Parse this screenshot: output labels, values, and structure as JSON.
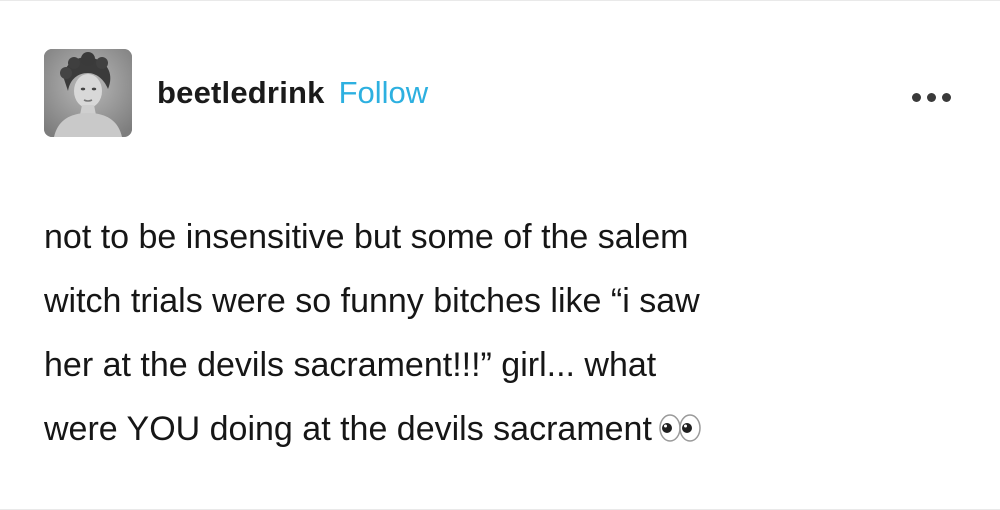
{
  "post": {
    "author": {
      "username": "beetledrink",
      "follow_label": "Follow",
      "avatar_icon": "avatar-portrait"
    },
    "menu_icon": "more-options-icon",
    "body_lines": [
      "not to be insensitive but some of the salem",
      "witch trials were so funny bitches like “i saw",
      "her at the devils sacrament!!!” girl... what",
      "were YOU doing at the devils sacrament"
    ],
    "emoji": "eyes-emoji"
  },
  "colors": {
    "accent": "#2db0e0",
    "text": "#161616",
    "background": "#ffffff"
  }
}
